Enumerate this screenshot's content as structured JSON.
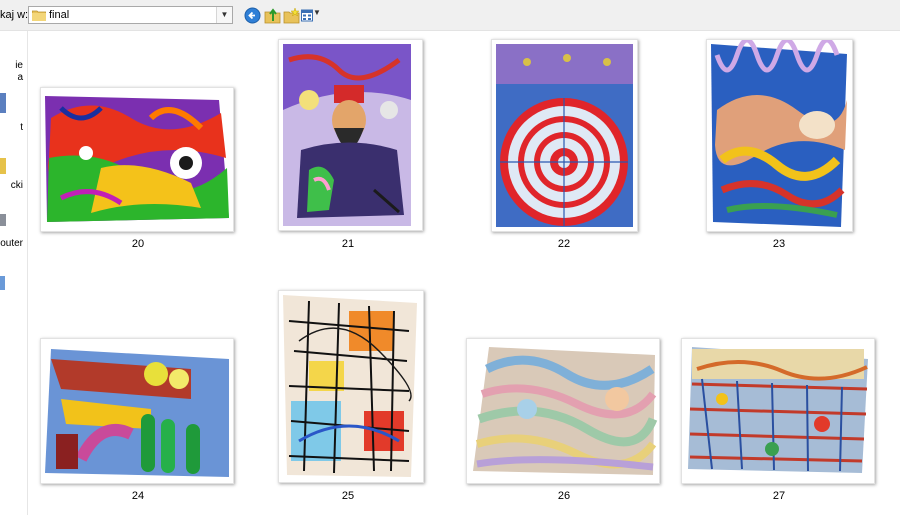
{
  "toolbar": {
    "look_in_label": "kaj w:",
    "path_value": "final"
  },
  "places": [
    {
      "label": "ie"
    },
    {
      "label": "a"
    },
    {
      "label": "t"
    },
    {
      "label": "cki"
    },
    {
      "label": "outer"
    }
  ],
  "files": [
    {
      "name": "20"
    },
    {
      "name": "21"
    },
    {
      "name": "22"
    },
    {
      "name": "23"
    },
    {
      "name": "24"
    },
    {
      "name": "25"
    },
    {
      "name": "26"
    },
    {
      "name": "27"
    }
  ]
}
